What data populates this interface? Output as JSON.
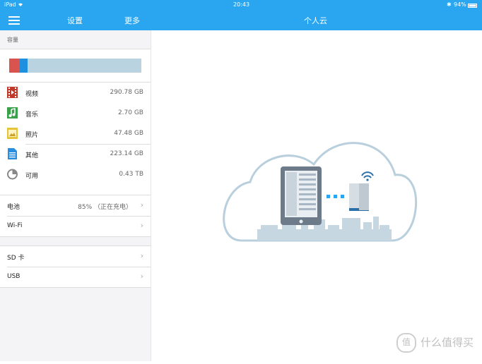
{
  "status_bar": {
    "carrier": "iPad",
    "time": "20:43",
    "battery": "94%"
  },
  "header": {
    "sidebar_title": "设置",
    "more_label": "更多",
    "main_title": "个人云"
  },
  "storage": {
    "section_label": "容量",
    "bar_segments": [
      {
        "name": "video",
        "color": "#d9534f",
        "fraction": 0.08
      },
      {
        "name": "music",
        "color": "#1f8fe0",
        "fraction": 0.06
      }
    ],
    "bar_background": "#bad3e1",
    "items": [
      {
        "label": "视频",
        "value": "290.78 GB",
        "icon": "video-icon",
        "color": "#c0392b"
      },
      {
        "label": "音乐",
        "value": "2.70 GB",
        "icon": "music-icon",
        "color": "#3aa04b"
      },
      {
        "label": "照片",
        "value": "47.48 GB",
        "icon": "photo-icon",
        "color": "#e6c43a"
      },
      {
        "label": "其他",
        "value": "223.14 GB",
        "icon": "document-icon",
        "color": "#2a8ee0"
      },
      {
        "label": "可用",
        "value": "0.43 TB",
        "icon": "pie-icon",
        "color": "#888888"
      }
    ]
  },
  "device": {
    "battery_label": "电池",
    "battery_value": "85% （正在充电）",
    "wifi_label": "Wi-Fi",
    "sd_label": "SD 卡",
    "usb_label": "USB"
  },
  "watermark": {
    "badge": "值",
    "text": "什么值得买"
  }
}
